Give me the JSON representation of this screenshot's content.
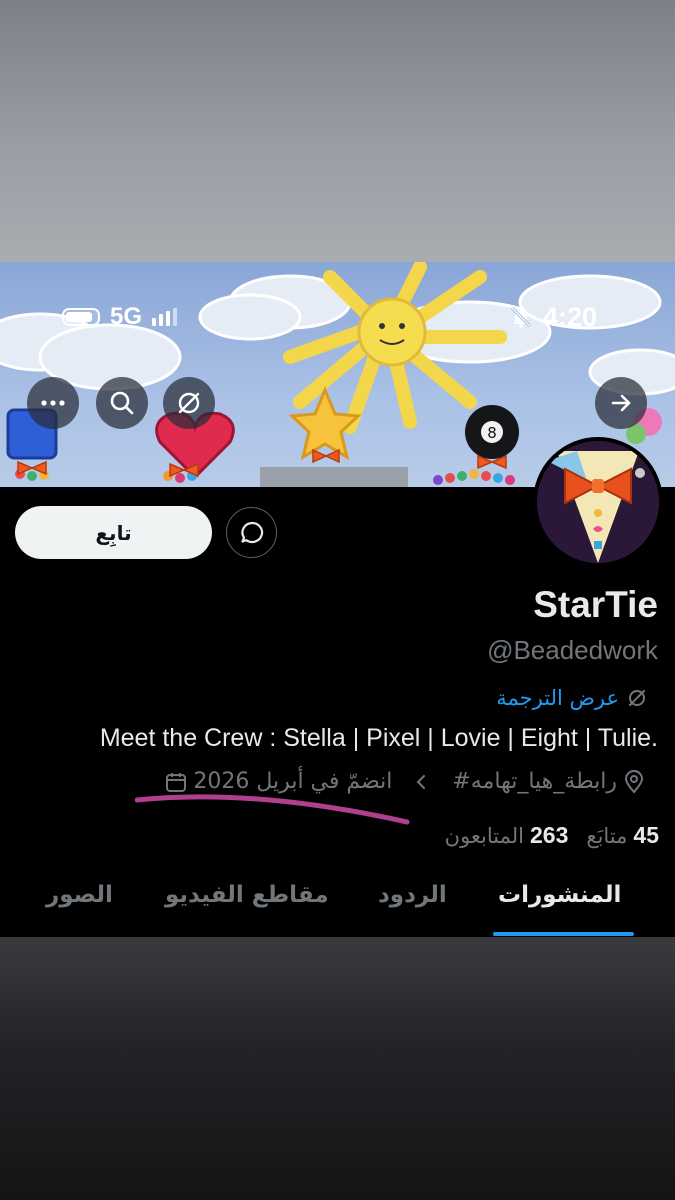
{
  "status_bar": {
    "network": "5G",
    "time": "4:20"
  },
  "header_buttons": [
    {
      "name": "more-icon"
    },
    {
      "name": "search-icon"
    },
    {
      "name": "grok-icon"
    },
    {
      "name": "forward-arrow-icon"
    }
  ],
  "actions": {
    "follow_label": "تابِع"
  },
  "profile": {
    "display_name": "StarTie",
    "handle": "@Beadedwork",
    "translate_label": "عرض الترجمة",
    "bio": "Meet the Crew : Stella | Pixel | Lovie | Eight | Tulie.",
    "location": "#رابطة_هيا_تهامه",
    "joined": "انضمّ في أبريل 2026"
  },
  "stats": {
    "following_count": "45",
    "following_label": "متابَع",
    "followers_count": "263",
    "followers_label": "المتابعون"
  },
  "tabs": [
    {
      "label": "المنشورات",
      "active": true
    },
    {
      "label": "الردود",
      "active": false
    },
    {
      "label": "مقاطع الفيديو",
      "active": false
    },
    {
      "label": "الصور",
      "active": false
    }
  ],
  "colors": {
    "accent": "#1d9bf0",
    "background": "#000000",
    "primary_text": "#e7e9ea",
    "secondary_text": "#71767b",
    "annotation": "#b0408e"
  }
}
